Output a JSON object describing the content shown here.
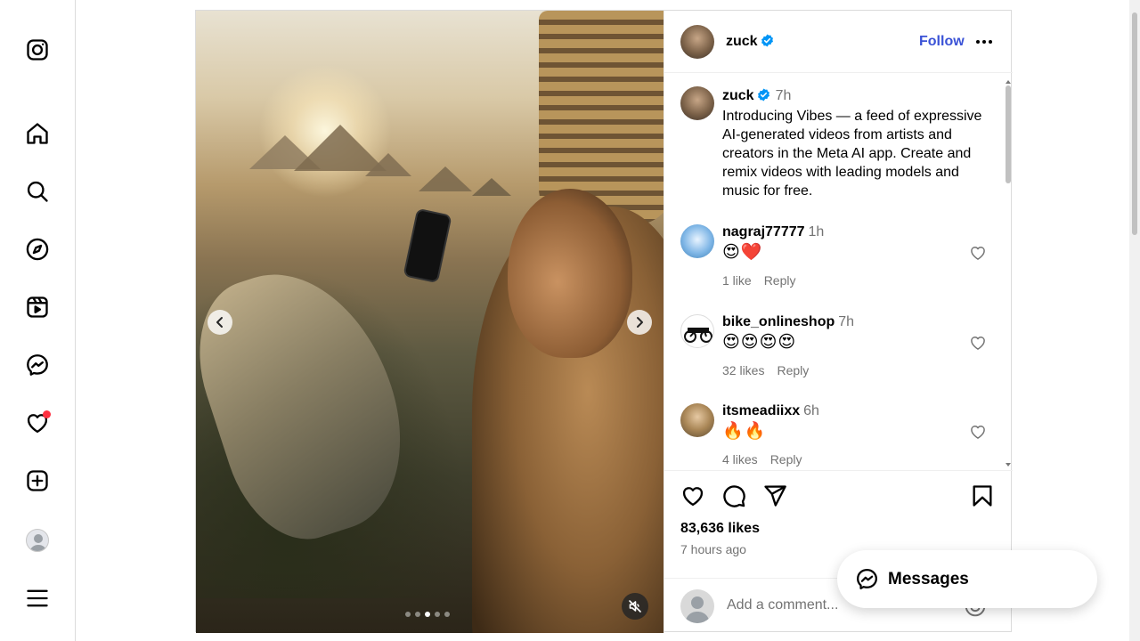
{
  "nav": {
    "items": [
      {
        "name": "instagram-logo-icon"
      },
      {
        "name": "home-icon"
      },
      {
        "name": "search-icon"
      },
      {
        "name": "explore-icon"
      },
      {
        "name": "reels-icon"
      },
      {
        "name": "messenger-icon"
      },
      {
        "name": "notifications-heart-icon"
      },
      {
        "name": "create-plus-icon"
      },
      {
        "name": "profile-avatar"
      },
      {
        "name": "more-menu-icon"
      }
    ],
    "notification_dot_color": "#ff3040"
  },
  "media": {
    "dots_total": 5,
    "active_dot": 3
  },
  "post": {
    "header": {
      "username": "zuck",
      "verified": true,
      "follow_label": "Follow"
    },
    "caption": {
      "username": "zuck",
      "time": "7h",
      "text": "Introducing Vibes — a feed of expressive AI-generated videos from artists and creators in the Meta AI app. Create and remix videos with leading models and music for free."
    },
    "comments": [
      {
        "username": "nagraj77777",
        "time": "1h",
        "text": "😍❤️",
        "likes": "1 like",
        "reply": "Reply"
      },
      {
        "username": "bike_onlineshop",
        "time": "7h",
        "text": "😍😍😍😍",
        "likes": "32 likes",
        "reply": "Reply"
      },
      {
        "username": "itsmeadiixx",
        "time": "6h",
        "text": "🔥🔥",
        "likes": "4 likes",
        "reply": "Reply"
      }
    ],
    "likes": "83,636 likes",
    "posted": "7 hours ago",
    "add_comment_placeholder": "Add a comment..."
  },
  "messages_pill": {
    "label": "Messages"
  },
  "colors": {
    "accent_link": "#3a52d6",
    "verified_blue": "#0095f6",
    "secondary_text": "#737373"
  }
}
